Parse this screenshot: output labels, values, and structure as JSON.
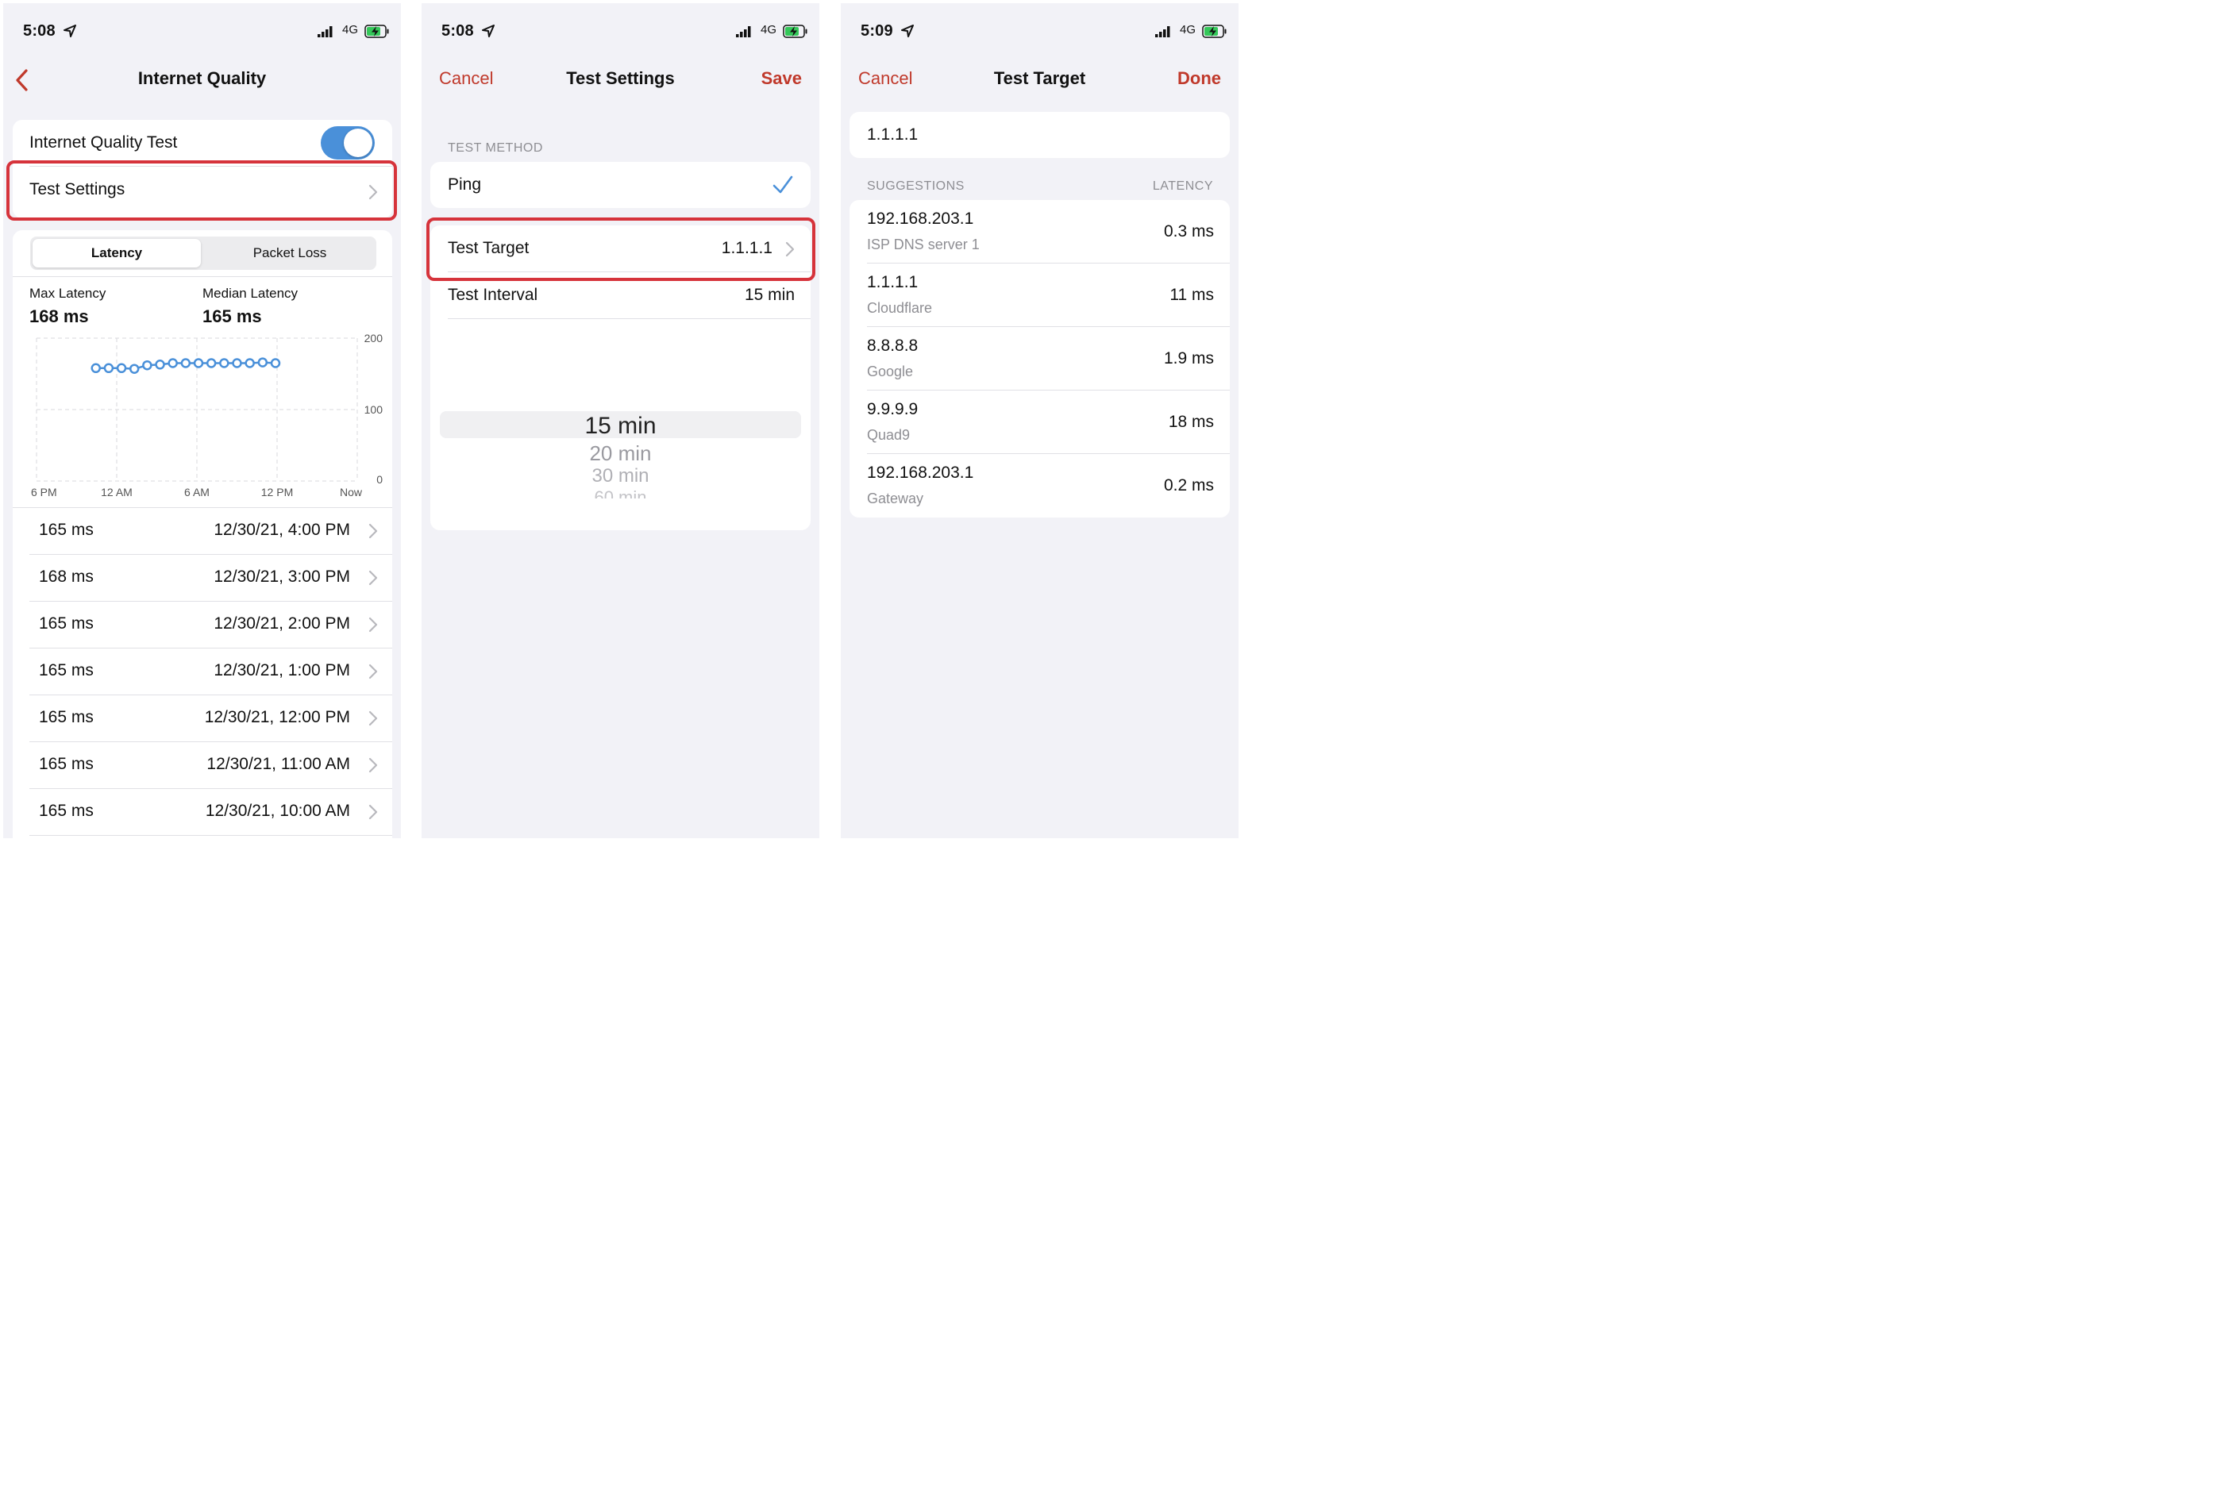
{
  "screens": [
    {
      "status": {
        "time": "5:08",
        "network": "4G"
      },
      "nav": {
        "title": "Internet Quality"
      },
      "toggle_row": {
        "label": "Internet Quality Test",
        "on": true
      },
      "settings_row": {
        "label": "Test Settings"
      },
      "segments": [
        "Latency",
        "Packet Loss"
      ],
      "stats": [
        {
          "label": "Max Latency",
          "value": "168 ms"
        },
        {
          "label": "Median Latency",
          "value": "165 ms"
        }
      ],
      "history": [
        {
          "value": "165 ms",
          "time": "12/30/21, 4:00 PM"
        },
        {
          "value": "168 ms",
          "time": "12/30/21, 3:00 PM"
        },
        {
          "value": "165 ms",
          "time": "12/30/21, 2:00 PM"
        },
        {
          "value": "165 ms",
          "time": "12/30/21, 1:00 PM"
        },
        {
          "value": "165 ms",
          "time": "12/30/21, 12:00 PM"
        },
        {
          "value": "165 ms",
          "time": "12/30/21, 11:00 AM"
        },
        {
          "value": "165 ms",
          "time": "12/30/21, 10:00 AM"
        }
      ]
    },
    {
      "status": {
        "time": "5:08",
        "network": "4G"
      },
      "nav": {
        "left": "Cancel",
        "title": "Test Settings",
        "right": "Save"
      },
      "method_header": "TEST METHOD",
      "method": "Ping",
      "target": {
        "label": "Test Target",
        "value": "1.1.1.1"
      },
      "interval": {
        "label": "Test Interval",
        "value": "15 min"
      },
      "picker_options": [
        "15 min",
        "20 min",
        "30 min",
        "60 min"
      ]
    },
    {
      "status": {
        "time": "5:09",
        "network": "4G"
      },
      "nav": {
        "left": "Cancel",
        "title": "Test Target",
        "right": "Done"
      },
      "input_value": "1.1.1.1",
      "header_left": "SUGGESTIONS",
      "header_right": "LATENCY",
      "suggestions": [
        {
          "ip": "192.168.203.1",
          "name": "ISP DNS server 1",
          "latency": "0.3 ms"
        },
        {
          "ip": "1.1.1.1",
          "name": "Cloudflare",
          "latency": "11 ms"
        },
        {
          "ip": "8.8.8.8",
          "name": "Google",
          "latency": "1.9 ms"
        },
        {
          "ip": "9.9.9.9",
          "name": "Quad9",
          "latency": "18 ms"
        },
        {
          "ip": "192.168.203.1",
          "name": "Gateway",
          "latency": "0.2 ms"
        }
      ]
    }
  ],
  "colors": {
    "accent": "#c0392b",
    "highlight": "#d6333b",
    "toggle": "#4a90d9",
    "series": "#4a90d9"
  },
  "chart_data": {
    "type": "line",
    "x_ticks": [
      "6 PM",
      "12 AM",
      "6 AM",
      "12 PM",
      "Now"
    ],
    "y_ticks": [
      "200",
      "100",
      "0"
    ],
    "ylim": [
      0,
      200
    ],
    "series": [
      {
        "x": [
          0.74,
          0.9,
          1.06,
          1.22,
          1.38,
          1.54,
          1.7,
          1.86,
          2.02,
          2.18,
          2.34,
          2.5,
          2.66,
          2.82,
          2.98
        ],
        "values": [
          158,
          158,
          158,
          157,
          162,
          163,
          165,
          165,
          165,
          165,
          165,
          165,
          165,
          166,
          165
        ]
      }
    ]
  }
}
